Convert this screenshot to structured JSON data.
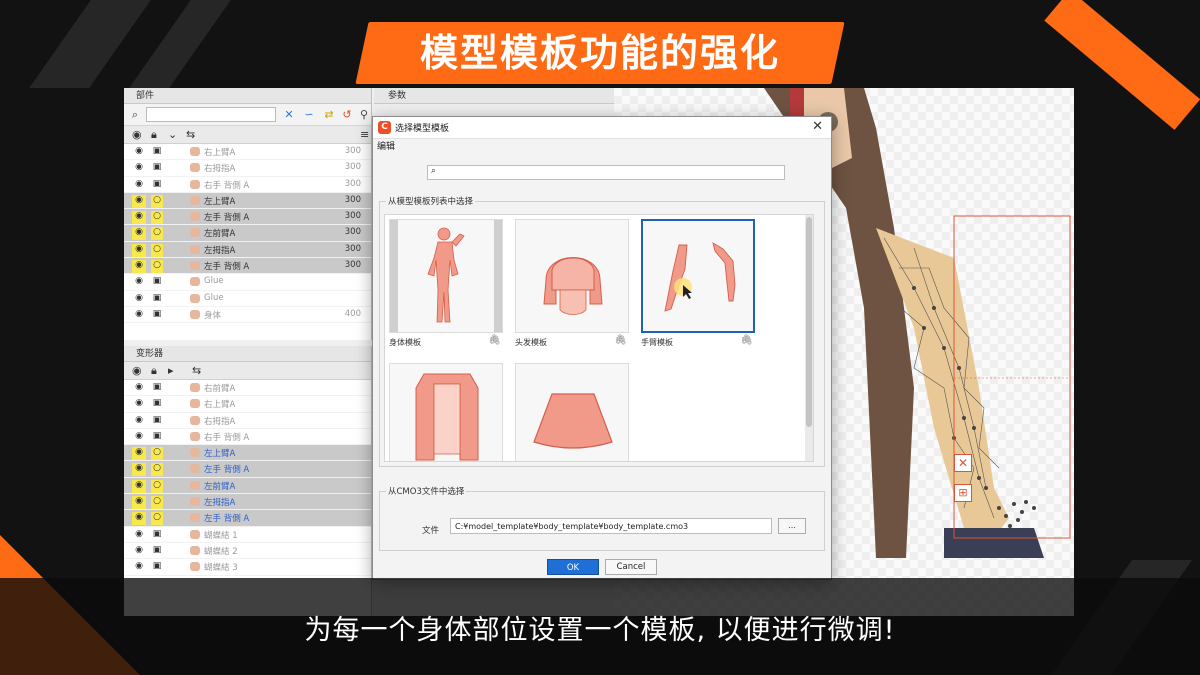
{
  "title": "模型模板功能的强化",
  "subtitle": "为每一个身体部位设置一个模板, 以便进行微调!",
  "colors": {
    "accent": "#ff6a14",
    "selection_blue": "#1f63b8",
    "ok_button": "#1f6fd6",
    "row_highlight": "#f6e84d"
  },
  "parts_panel": {
    "header": "部件",
    "rows": [
      {
        "label": "右上臂A",
        "value": "300",
        "selected": false
      },
      {
        "label": "右拇指A",
        "value": "300",
        "selected": false
      },
      {
        "label": "右手 背側 A",
        "value": "300",
        "selected": false
      },
      {
        "label": "左上臂A",
        "value": "300",
        "selected": true
      },
      {
        "label": "左手 背側 A",
        "value": "300",
        "selected": true
      },
      {
        "label": "左前臂A",
        "value": "300",
        "selected": true
      },
      {
        "label": "左拇指A",
        "value": "300",
        "selected": true
      },
      {
        "label": "左手 背側 A",
        "value": "300",
        "selected": true
      },
      {
        "label": "Glue",
        "value": "",
        "selected": false
      },
      {
        "label": "Glue",
        "value": "",
        "selected": false
      },
      {
        "label": "身体",
        "value": "400",
        "selected": false
      }
    ]
  },
  "deformer_panel": {
    "header": "变形器",
    "rows": [
      {
        "label": "右前臂A",
        "selected": false
      },
      {
        "label": "右上臂A",
        "selected": false
      },
      {
        "label": "右拇指A",
        "selected": false
      },
      {
        "label": "右手 背側 A",
        "selected": false
      },
      {
        "label": "左上臂A",
        "selected": true
      },
      {
        "label": "左手 背側 A",
        "selected": true
      },
      {
        "label": "左前臂A",
        "selected": true
      },
      {
        "label": "左拇指A",
        "selected": true
      },
      {
        "label": "左手 背側 A",
        "selected": true
      },
      {
        "label": "蝴蝶結 1",
        "selected": false
      },
      {
        "label": "蝴蝶結 2",
        "selected": false
      },
      {
        "label": "蝴蝶結 3",
        "selected": false
      }
    ]
  },
  "param_panel": {
    "header": "参数"
  },
  "dialog": {
    "title": "选择模型模板",
    "menu": "编辑",
    "search_placeholder": "",
    "list_group_label": "从模型模板列表中选择",
    "templates": [
      {
        "name": "身体模板",
        "icon": "paperclip-icon",
        "selected": false
      },
      {
        "name": "头发模板",
        "icon": "paperclip-icon",
        "selected": false
      },
      {
        "name": "手臂模板",
        "icon": "paperclip-icon",
        "selected": true
      },
      {
        "name": "",
        "icon": "",
        "selected": false
      },
      {
        "name": "",
        "icon": "",
        "selected": false
      }
    ],
    "file_group_label": "从CMO3文件中选择",
    "file_label": "文件",
    "file_path": "C:¥model_template¥body_template¥body_template.cmo3",
    "browse_label": "...",
    "ok_label": "OK",
    "cancel_label": "Cancel"
  }
}
